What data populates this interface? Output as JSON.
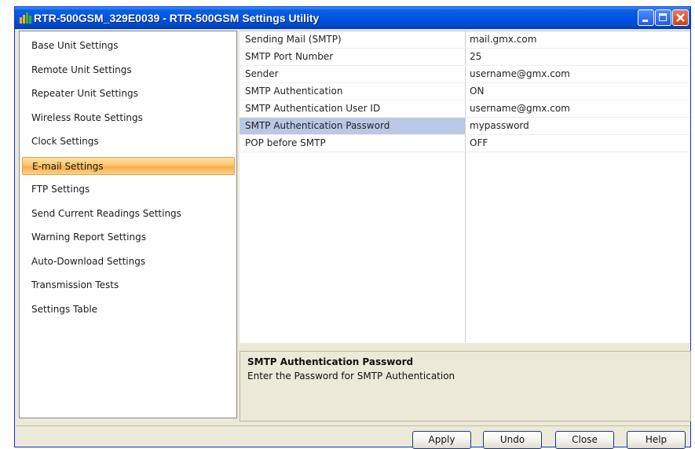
{
  "window": {
    "title": "RTR-500GSM_329E0039 - RTR-500GSM Settings Utility"
  },
  "sidebar": {
    "items": [
      {
        "label": "Base Unit Settings"
      },
      {
        "label": "Remote Unit Settings"
      },
      {
        "label": "Repeater Unit Settings"
      },
      {
        "label": "Wireless Route Settings"
      },
      {
        "label": "Clock Settings"
      },
      {
        "label": "E-mail Settings",
        "selected": true
      },
      {
        "label": "FTP Settings"
      },
      {
        "label": "Send Current Readings Settings"
      },
      {
        "label": "Warning Report Settings"
      },
      {
        "label": "Auto-Download Settings"
      },
      {
        "label": "Transmission  Tests"
      },
      {
        "label": "Settings Table"
      }
    ]
  },
  "properties": {
    "rows": [
      {
        "name": "Sending Mail (SMTP)",
        "value": "mail.gmx.com"
      },
      {
        "name": "SMTP Port Number",
        "value": "25"
      },
      {
        "name": "Sender",
        "value": "username@gmx.com"
      },
      {
        "name": "SMTP Authentication",
        "value": "ON"
      },
      {
        "name": "SMTP Authentication User ID",
        "value": "username@gmx.com"
      },
      {
        "name": "SMTP Authentication Password",
        "value": "mypassword",
        "selected": true
      },
      {
        "name": "POP before SMTP",
        "value": "OFF"
      }
    ]
  },
  "description": {
    "title": "SMTP Authentication Password",
    "text": "Enter the Password for SMTP Authentication"
  },
  "buttons": {
    "apply": "Apply",
    "undo": "Undo",
    "close": "Close",
    "help": "Help"
  },
  "colors": {
    "titlebar": "#0055e5",
    "selected_nav": "#f8b04a",
    "selected_row": "#b9c9e5",
    "close_button": "#c8401a"
  }
}
